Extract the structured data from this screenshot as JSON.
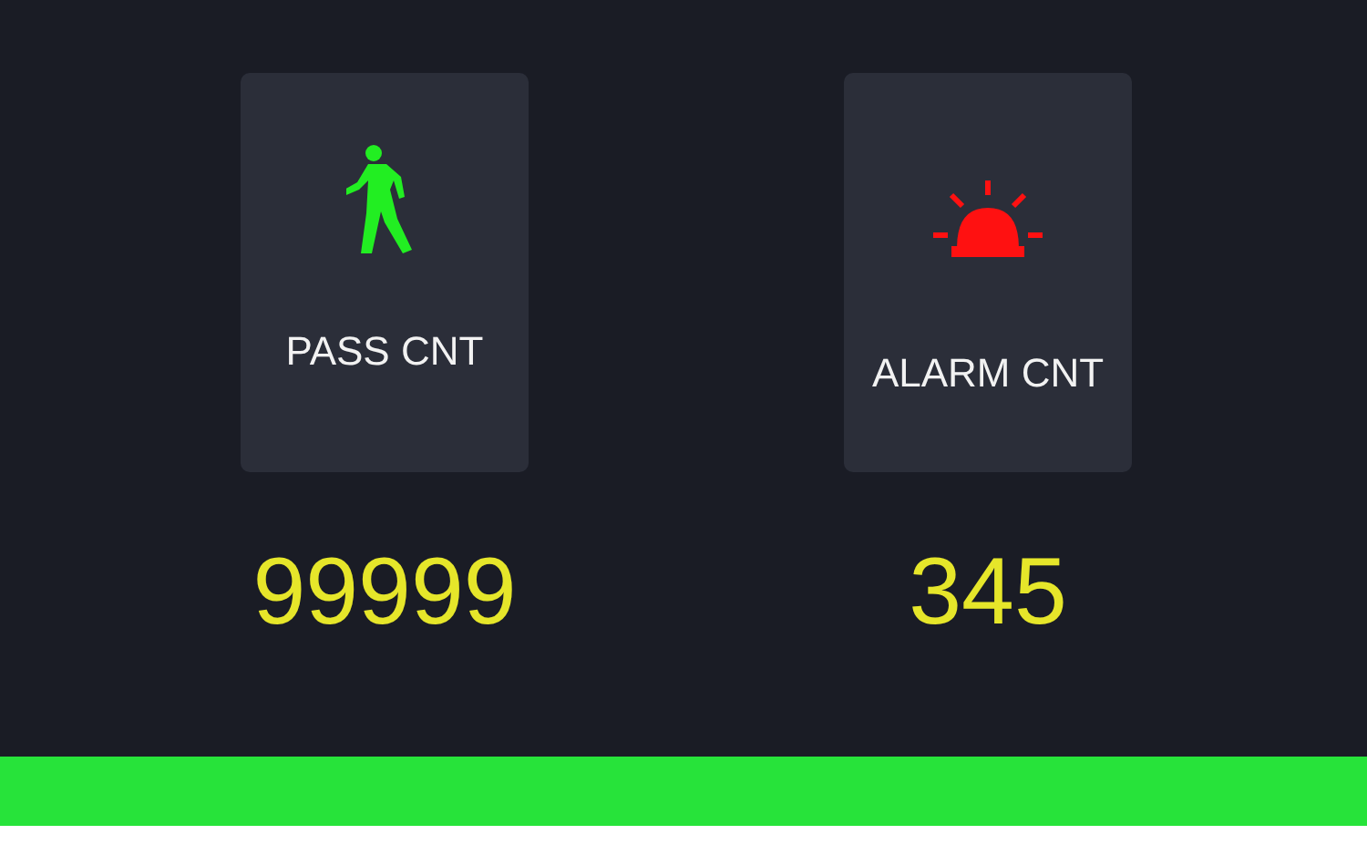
{
  "counters": [
    {
      "kind": "pass",
      "label": "PASS CNT",
      "value": "99999"
    },
    {
      "kind": "alarm",
      "label": "ALARM CNT",
      "value": "345"
    }
  ]
}
